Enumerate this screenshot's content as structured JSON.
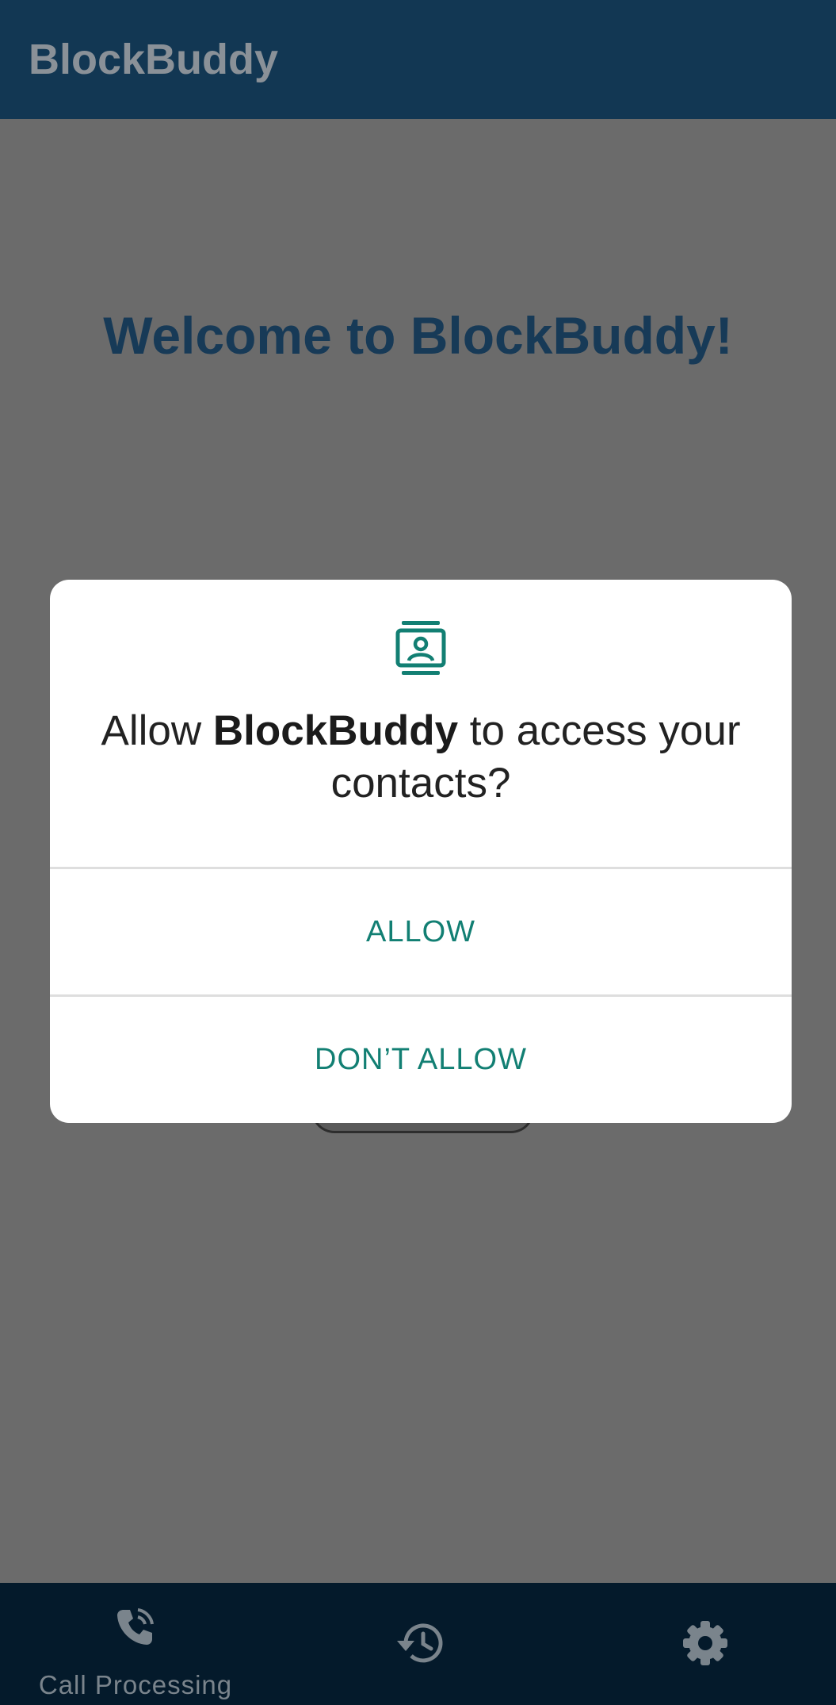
{
  "app_bar": {
    "title": "BlockBuddy"
  },
  "main": {
    "welcome_text": "Welcome to BlockBuddy!"
  },
  "permission_dialog": {
    "icon": "contacts-icon",
    "message_prefix": "Allow ",
    "app_name": "BlockBuddy",
    "message_suffix": " to access your contacts?",
    "allow_label": "ALLOW",
    "deny_label": "DON’T ALLOW"
  },
  "bottom_nav": {
    "items": [
      {
        "icon": "phone-call-icon",
        "label": "Call Processing"
      },
      {
        "icon": "history-icon",
        "label": ""
      },
      {
        "icon": "settings-gear-icon",
        "label": ""
      }
    ]
  },
  "colors": {
    "app_bar": "#123753",
    "scrim_background": "#6b6b6b",
    "dialog_accent": "#127f73",
    "bottom_nav": "#041a2b"
  }
}
